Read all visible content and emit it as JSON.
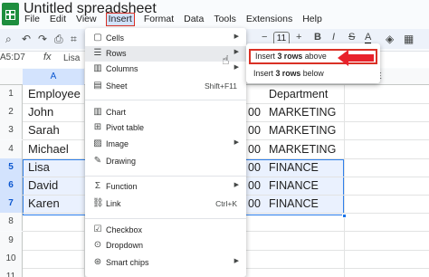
{
  "title_bar": {
    "document_title": "Untitled spreadsheet"
  },
  "menubar": {
    "items": [
      {
        "label": "File"
      },
      {
        "label": "Edit"
      },
      {
        "label": "View"
      },
      {
        "label": "Insert"
      },
      {
        "label": "Format"
      },
      {
        "label": "Data"
      },
      {
        "label": "Tools"
      },
      {
        "label": "Extensions"
      },
      {
        "label": "Help"
      }
    ]
  },
  "toolbar": {
    "font_size": "11",
    "bold": "B",
    "italic": "I",
    "strike": "S",
    "text_color": "A",
    "icons": [
      "search-icon",
      "undo-icon",
      "redo-icon",
      "print-icon",
      "paint-format-icon",
      "decrease-font-icon",
      "increase-font-icon",
      "fill-color-icon"
    ]
  },
  "formula_bar": {
    "name_box": "A5:D7",
    "fx": "fx",
    "value": "Lisa"
  },
  "grid": {
    "col_a": "A",
    "col_e": "E",
    "rows": [
      {
        "num": "1",
        "a": "Employee",
        "d": "Department",
        "trunc": ""
      },
      {
        "num": "2",
        "a": "John",
        "d": "MARKETING",
        "trunc": "00"
      },
      {
        "num": "3",
        "a": "Sarah",
        "d": "MARKETING",
        "trunc": "00"
      },
      {
        "num": "4",
        "a": "Michael",
        "d": "MARKETING",
        "trunc": "00"
      },
      {
        "num": "5",
        "a": "Lisa",
        "d": "FINANCE",
        "trunc": "00"
      },
      {
        "num": "6",
        "a": "David",
        "d": "FINANCE",
        "trunc": "00"
      },
      {
        "num": "7",
        "a": "Karen",
        "d": "FINANCE",
        "trunc": "00"
      },
      {
        "num": "8",
        "a": "",
        "d": "",
        "trunc": ""
      },
      {
        "num": "9",
        "a": "",
        "d": "",
        "trunc": ""
      },
      {
        "num": "10",
        "a": "",
        "d": "",
        "trunc": ""
      },
      {
        "num": "11",
        "a": "",
        "d": "",
        "trunc": ""
      }
    ]
  },
  "insert_menu": {
    "items": [
      {
        "label": "Cells",
        "icon": "cells-icon",
        "arrow": true
      },
      {
        "label": "Rows",
        "icon": "rows-icon",
        "arrow": true
      },
      {
        "label": "Columns",
        "icon": "columns-icon",
        "arrow": true
      },
      {
        "label": "Sheet",
        "icon": "sheet-icon",
        "shortcut": "Shift+F11"
      },
      {
        "label": "Chart",
        "icon": "chart-icon"
      },
      {
        "label": "Pivot table",
        "icon": "pivot-table-icon"
      },
      {
        "label": "Image",
        "icon": "image-icon",
        "arrow": true
      },
      {
        "label": "Drawing",
        "icon": "drawing-icon"
      },
      {
        "label": "Function",
        "icon": "function-icon",
        "arrow": true
      },
      {
        "label": "Link",
        "icon": "link-icon",
        "shortcut": "Ctrl+K"
      },
      {
        "label": "Checkbox",
        "icon": "checkbox-icon"
      },
      {
        "label": "Dropdown",
        "icon": "dropdown-icon"
      },
      {
        "label": "Smart chips",
        "icon": "smart-chips-icon",
        "arrow": true
      }
    ]
  },
  "rows_submenu": {
    "above": {
      "pre": "Insert ",
      "count": "3 rows",
      "post": " above"
    },
    "below": {
      "pre": "Insert ",
      "count": "3 rows",
      "post": " below"
    }
  },
  "colors": {
    "accent": "#1a73e8",
    "highlight_red": "#d93025",
    "selection": "#d3e3fd"
  }
}
